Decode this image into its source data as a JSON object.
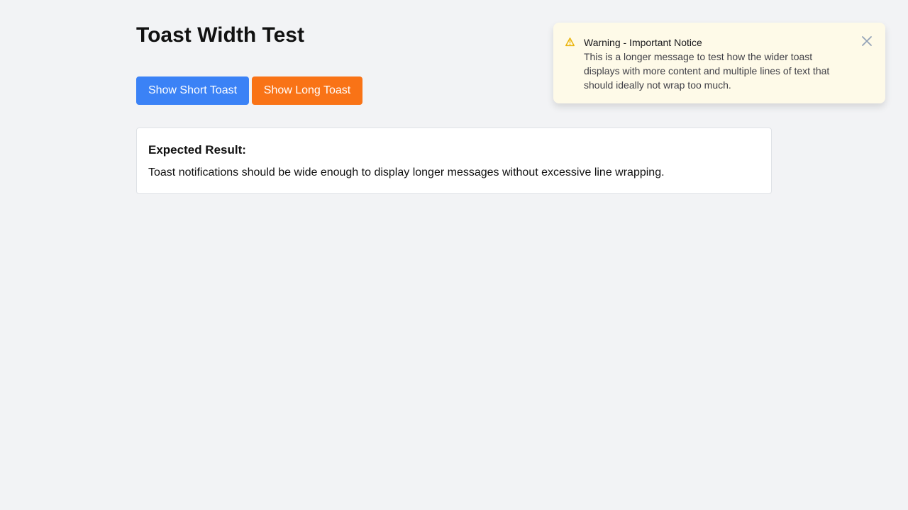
{
  "page": {
    "title": "Toast Width Test"
  },
  "buttons": {
    "short_label": "Show Short Toast",
    "long_label": "Show Long Toast"
  },
  "result": {
    "heading": "Expected Result:",
    "text": "Toast notifications should be wide enough to display longer messages without excessive line wrapping."
  },
  "toast": {
    "title": "Warning - Important Notice",
    "message": "This is a longer message to test how the wider toast displays with more content and multiple lines of text that should ideally not wrap too much.",
    "icon": "warning-icon",
    "close_icon": "close-icon"
  },
  "colors": {
    "background": "#f2f3f5",
    "short_button": "#3b82f6",
    "long_button": "#f97316",
    "toast_background": "#fefae8",
    "warning_icon": "#eab308",
    "close_icon": "#94a3b8"
  }
}
